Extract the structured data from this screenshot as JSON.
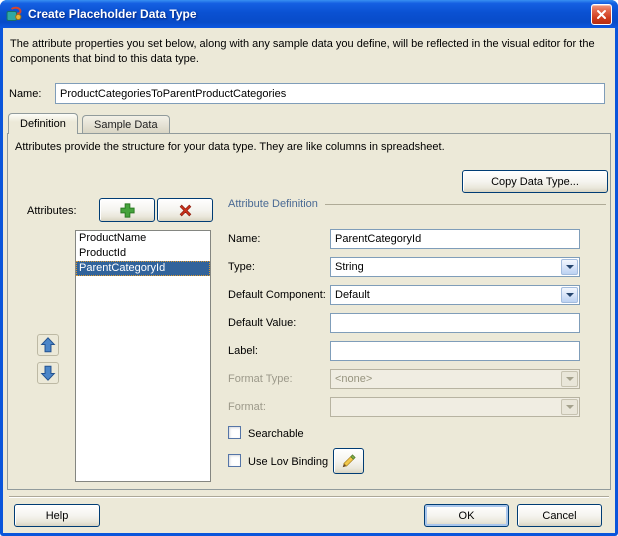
{
  "colors": {
    "titlebar_blue": "#0A55DB",
    "selection_blue": "#31639B",
    "section_header_blue": "#4A6A94",
    "add_green": "#45A33C",
    "delete_red": "#D0321C"
  },
  "window": {
    "title": "Create Placeholder Data Type"
  },
  "description": "The attribute properties you set below, along with any sample data you define, will be reflected in the visual editor for the components that bind to this data type.",
  "name_field": {
    "label": "Name:",
    "value": "ProductCategoriesToParentProductCategories"
  },
  "tabs": [
    {
      "label": "Definition",
      "active": true
    },
    {
      "label": "Sample Data",
      "active": false
    }
  ],
  "definition_tab": {
    "hint": "Attributes provide the structure for your data type. They are like columns in spreadsheet.",
    "copy_button_label": "Copy Data Type...",
    "attributes_label": "Attributes:",
    "attribute_list": [
      "ProductName",
      "ProductId",
      "ParentCategoryId"
    ],
    "selected_attribute": "ParentCategoryId",
    "section_title": "Attribute Definition",
    "fields": {
      "name": {
        "label": "Name:",
        "value": "ParentCategoryId"
      },
      "type": {
        "label": "Type:",
        "value": "String"
      },
      "default_component": {
        "label": "Default Component:",
        "value": "Default"
      },
      "default_value": {
        "label": "Default Value:",
        "value": ""
      },
      "label": {
        "label": "Label:",
        "value": ""
      },
      "format_type": {
        "label": "Format Type:",
        "value": "<none>",
        "disabled": true
      },
      "format": {
        "label": "Format:",
        "value": "",
        "disabled": true
      }
    },
    "searchable": {
      "label": "Searchable",
      "checked": false
    },
    "use_lov_binding": {
      "label": "Use Lov Binding",
      "checked": false
    }
  },
  "footer": {
    "help_label": "Help",
    "ok_label": "OK",
    "cancel_label": "Cancel"
  }
}
